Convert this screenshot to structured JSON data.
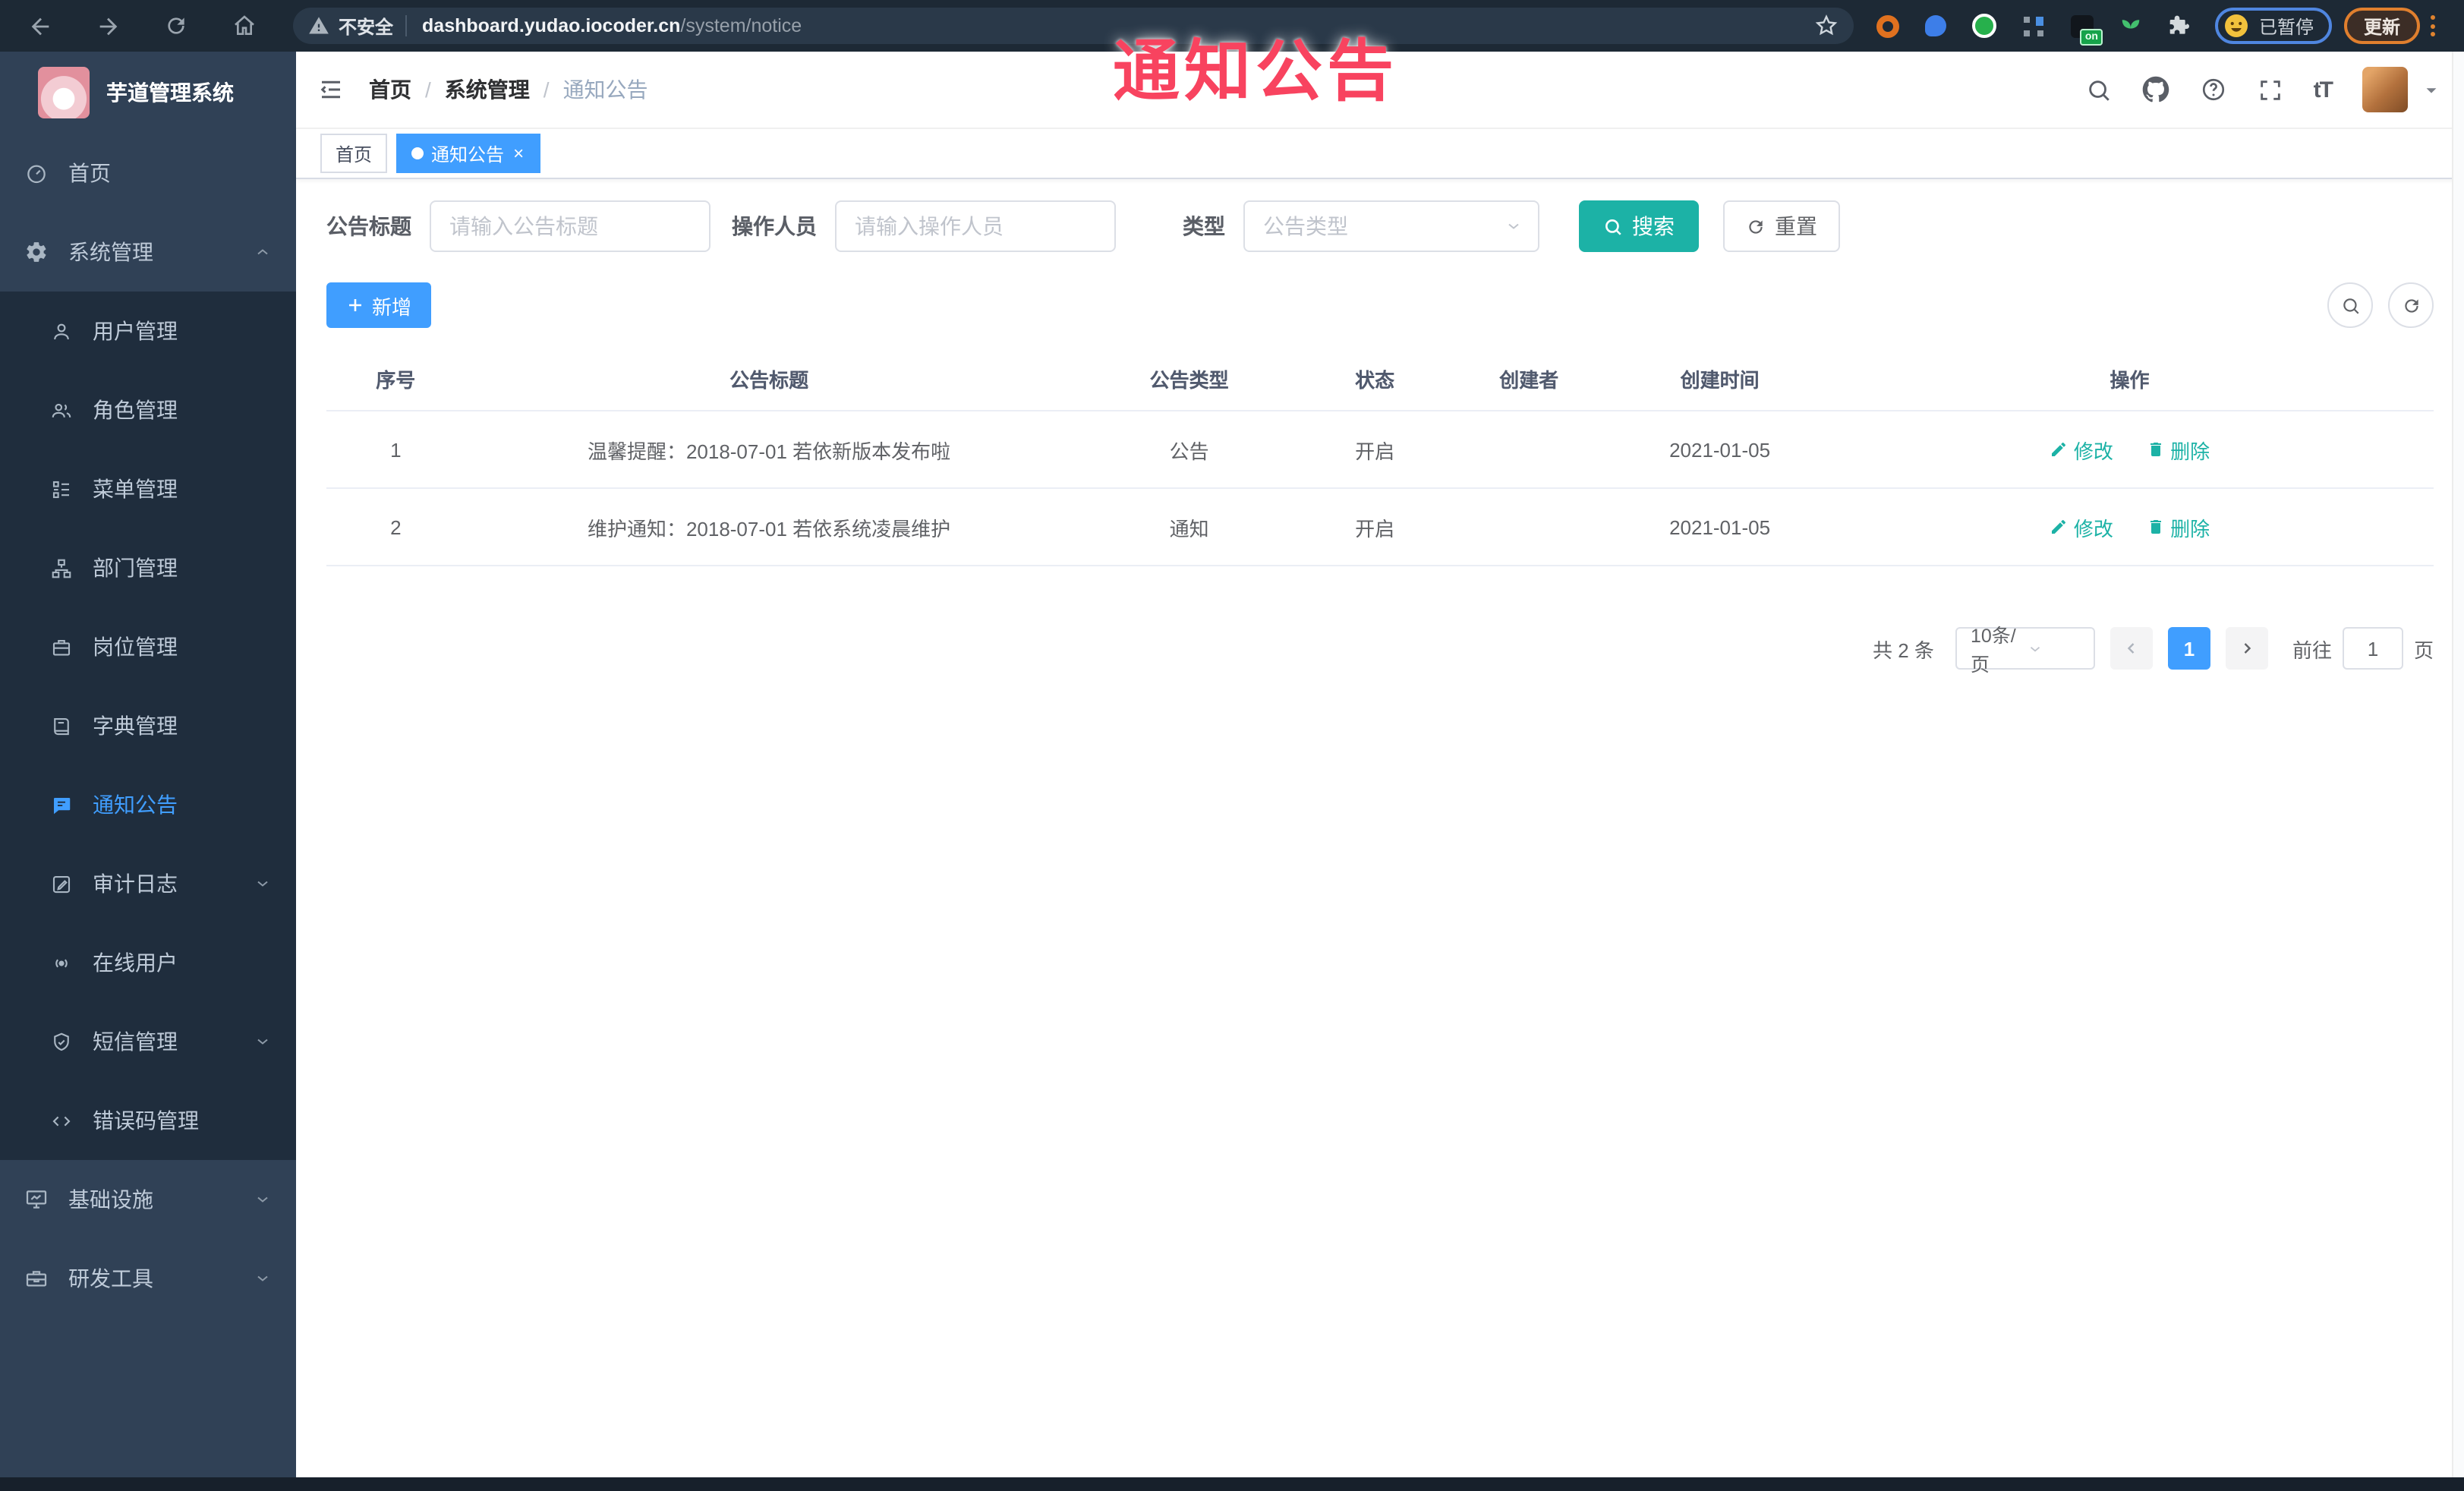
{
  "browser": {
    "security_label": "不安全",
    "url_host": "dashboard.yudao.iocoder.cn",
    "url_path": "/system/notice",
    "extension_badge": "on",
    "profile_label": "已暂停",
    "update_label": "更新"
  },
  "watermark": "通知公告",
  "sidebar": {
    "title": "芋道管理系统",
    "top": [
      {
        "label": "首页"
      },
      {
        "label": "系统管理"
      }
    ],
    "submenu": [
      {
        "label": "用户管理"
      },
      {
        "label": "角色管理"
      },
      {
        "label": "菜单管理"
      },
      {
        "label": "部门管理"
      },
      {
        "label": "岗位管理"
      },
      {
        "label": "字典管理"
      },
      {
        "label": "通知公告"
      },
      {
        "label": "审计日志"
      },
      {
        "label": "在线用户"
      },
      {
        "label": "短信管理"
      },
      {
        "label": "错误码管理"
      }
    ],
    "bottom": [
      {
        "label": "基础设施"
      },
      {
        "label": "研发工具"
      }
    ]
  },
  "breadcrumb": {
    "items": [
      "首页",
      "系统管理",
      "通知公告"
    ],
    "separator": "/"
  },
  "tags": [
    {
      "label": "首页"
    },
    {
      "label": "通知公告",
      "close": "×"
    }
  ],
  "filters": {
    "title_label": "公告标题",
    "title_placeholder": "请输入公告标题",
    "operator_label": "操作人员",
    "operator_placeholder": "请输入操作人员",
    "type_label": "类型",
    "type_placeholder": "公告类型",
    "search_label": "搜索",
    "reset_label": "重置"
  },
  "toolbar": {
    "add_label": "新增"
  },
  "table": {
    "headers": [
      "序号",
      "公告标题",
      "公告类型",
      "状态",
      "创建者",
      "创建时间",
      "操作"
    ],
    "rows": [
      {
        "no": "1",
        "title": "温馨提醒：2018-07-01 若依新版本发布啦",
        "type": "公告",
        "status": "开启",
        "creator": "",
        "created": "2021-01-05",
        "edit": "修改",
        "del": "删除"
      },
      {
        "no": "2",
        "title": "维护通知：2018-07-01 若依系统凌晨维护",
        "type": "通知",
        "status": "开启",
        "creator": "",
        "created": "2021-01-05",
        "edit": "修改",
        "del": "删除"
      }
    ]
  },
  "pagination": {
    "total": "共 2 条",
    "page_size": "10条/页",
    "current": "1",
    "goto_label": "前往",
    "goto_value": "1",
    "unit_label": "页"
  },
  "colors": {
    "accent": "#409EFF",
    "teal_button": "#1CB2A6",
    "watermark_pink": "#F8435F",
    "sidebar_bg": "#304156",
    "submenu_bg": "#1F2D3D",
    "browser_bar": "#1D2935"
  }
}
